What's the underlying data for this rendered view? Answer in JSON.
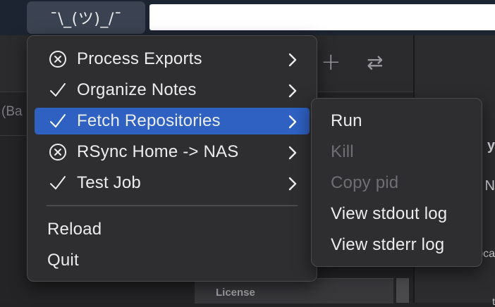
{
  "menubar": {
    "status_item_label": "¯\\_(ツ)_/¯"
  },
  "background": {
    "partial_label_left": "(Ba",
    "panel_label": "License",
    "edge_texts": [
      "y",
      "N",
      "oca",
      "t"
    ]
  },
  "main_menu": {
    "items": [
      {
        "label": "Process Exports",
        "status": "error",
        "icon": "x-circle-icon",
        "has_submenu": true
      },
      {
        "label": "Organize Notes",
        "status": "ok",
        "icon": "checkmark-icon",
        "has_submenu": true
      },
      {
        "label": "Fetch Repositories",
        "status": "ok",
        "icon": "checkmark-icon",
        "has_submenu": true,
        "selected": true
      },
      {
        "label": "RSync Home -> NAS",
        "status": "error",
        "icon": "x-circle-icon",
        "has_submenu": true
      },
      {
        "label": "Test Job",
        "status": "ok",
        "icon": "checkmark-icon",
        "has_submenu": true
      }
    ],
    "reload_label": "Reload",
    "quit_label": "Quit"
  },
  "submenu": {
    "items": [
      {
        "label": "Run",
        "enabled": true
      },
      {
        "label": "Kill",
        "enabled": false
      },
      {
        "label": "Copy pid",
        "enabled": false
      },
      {
        "label": "View stdout log",
        "enabled": true
      },
      {
        "label": "View stderr log",
        "enabled": true
      }
    ]
  },
  "colors": {
    "selection": "#2e61c2",
    "menu_bg": "#2e2e30",
    "text": "#ececec",
    "disabled_text": "#6f6f73"
  }
}
